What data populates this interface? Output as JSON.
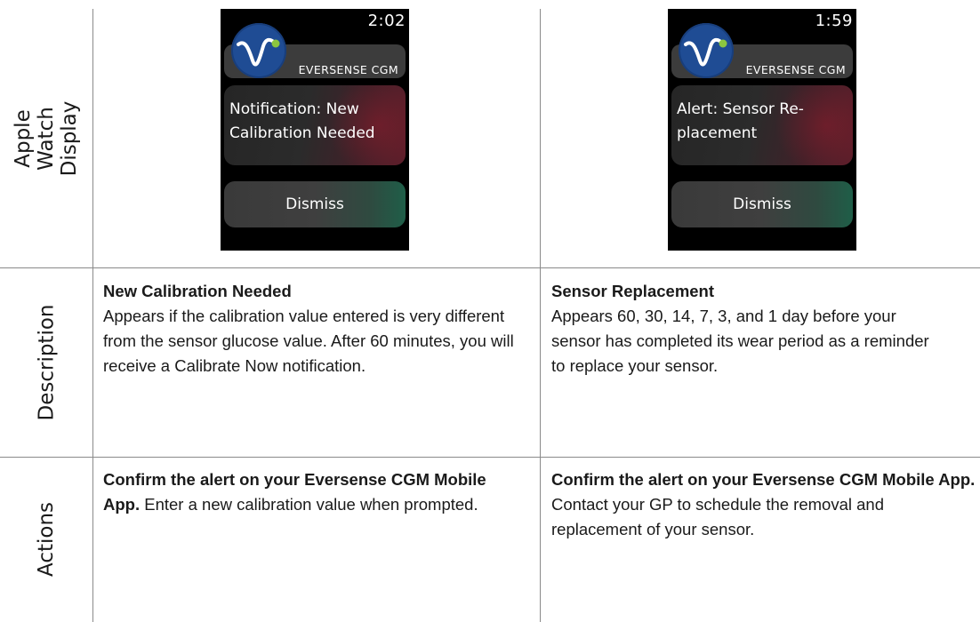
{
  "rows": {
    "display": "Apple Watch Display",
    "description": "Description",
    "actions": "Actions"
  },
  "watch_1": {
    "time": "2:02",
    "brand": "EVERSENSE CGM",
    "message": "Notification: New Calibration Needed",
    "button": "Dismiss"
  },
  "watch_2": {
    "time": "1:59",
    "brand": "EVERSENSE CGM",
    "message": "Alert: Sensor Re-placement",
    "button": "Dismiss"
  },
  "col_1": {
    "description_title": "New Calibration Needed",
    "description_body": "Appears if the calibration value entered is very different from the sensor glucose value. After 60 minutes, you will receive a Calibrate Now notification.",
    "action_bold": "Confirm the alert on your Eversense CGM Mobile App.",
    "action_text": " Enter a new calibration value when prompted."
  },
  "col_2": {
    "description_title": "Sensor Replacement",
    "description_body": "Appears 60, 30, 14, 7, 3, and 1 day before your sensor has completed its wear period as a reminder to replace your sensor.",
    "action_bold": "Confirm the alert on your Eversense CGM Mobile App.",
    "action_text": " Contact your GP to schedule the removal and replacement of your sensor."
  },
  "colors": {
    "logo_blue": "#1f4c94",
    "logo_dot": "#8cc63f",
    "grid": "#8a8a8a"
  }
}
